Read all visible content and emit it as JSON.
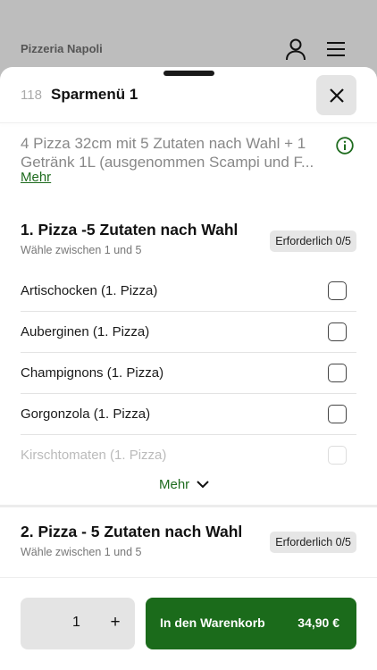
{
  "header": {
    "brand": "Pizzeria Napoli"
  },
  "sheet": {
    "item_number": "118",
    "title": "Sparmenü 1",
    "description": "4 Pizza 32cm mit 5 Zutaten nach Wahl + 1 Getränk 1L (ausgenommen Scampi und F...",
    "more_label": "Mehr"
  },
  "groups": [
    {
      "title": "1. Pizza -5  Zutaten nach Wahl",
      "subtitle": "Wähle zwischen 1 und 5",
      "badge": "Erforderlich 0/5",
      "options": [
        {
          "label": "Artischocken (1. Pizza)",
          "checked": false
        },
        {
          "label": "Auberginen (1. Pizza)",
          "checked": false
        },
        {
          "label": "Champignons (1. Pizza)",
          "checked": false
        },
        {
          "label": "Gorgonzola (1. Pizza)",
          "checked": false
        },
        {
          "label": "Kirschtomaten (1. Pizza)",
          "checked": false
        }
      ],
      "expand_label": "Mehr"
    },
    {
      "title": "2. Pizza - 5 Zutaten nach Wahl",
      "subtitle": "Wähle zwischen 1 und 5",
      "badge": "Erforderlich 0/5"
    }
  ],
  "footer": {
    "quantity": "1",
    "plus_label": "+",
    "cart_label": "In den Warenkorb",
    "price": "34,90 €"
  },
  "colors": {
    "accent": "#1b6b1b",
    "link": "#1e6b1e"
  },
  "icons": [
    "user-icon",
    "menu-icon",
    "close-icon",
    "info-icon",
    "chevron-down-icon"
  ]
}
